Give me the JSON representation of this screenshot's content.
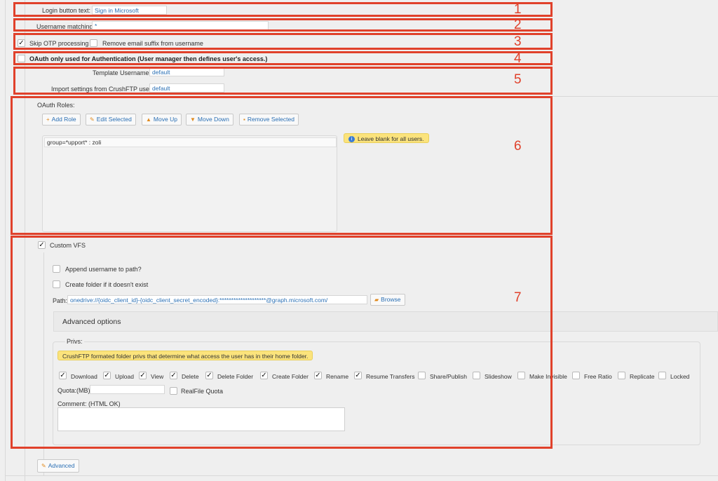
{
  "login": {
    "label": "Login button text:",
    "value": "Sign in Microsoft"
  },
  "username_matching": {
    "label": "Username matching:",
    "value": "*"
  },
  "options": {
    "skip_otp": {
      "label": "Skip OTP processing",
      "checked": true
    },
    "remove_suffix": {
      "label": "Remove email suffix from username",
      "checked": false
    },
    "oauth_only": {
      "label": "OAuth only used for Authentication (User manager then defines user's access.)",
      "checked": false
    }
  },
  "template_username": {
    "label": "Template Username:",
    "value": "default"
  },
  "import_settings": {
    "label": "Import settings from CrushFTP user:",
    "value": "default"
  },
  "roles": {
    "title": "OAuth Roles:",
    "buttons": {
      "add": "Add Role",
      "edit": "Edit Selected",
      "up": "Move Up",
      "down": "Move Down",
      "remove": "Remove Selected"
    },
    "items": [
      "group=*upport* : zoli"
    ],
    "hint": "Leave blank for all users."
  },
  "vfs": {
    "custom_label": "Custom VFS",
    "custom_checked": true,
    "append_label": "Append username to path?",
    "create_label": "Create folder if it doesn't exist",
    "path_label": "Path:",
    "path_value": "onedrive://{oidc_client_id}-{oidc_client_secret_encoded}:********************@graph.microsoft.com/",
    "browse": "Browse",
    "advanced_options": "Advanced options",
    "privs_title": "Privs:",
    "privs_note": "CrushFTP formated folder privs that determine what access the user has in their home folder.",
    "privs": [
      {
        "label": "Download",
        "checked": true
      },
      {
        "label": "Upload",
        "checked": true
      },
      {
        "label": "View",
        "checked": true
      },
      {
        "label": "Delete",
        "checked": true
      },
      {
        "label": "Delete Folder",
        "checked": true
      },
      {
        "label": "Create Folder",
        "checked": true
      },
      {
        "label": "Rename",
        "checked": true
      },
      {
        "label": "Resume Transfers",
        "checked": true
      },
      {
        "label": "Share/Publish",
        "checked": false
      },
      {
        "label": "Slideshow",
        "checked": false
      },
      {
        "label": "Make Invisible",
        "checked": false
      },
      {
        "label": "Free Ratio",
        "checked": false
      },
      {
        "label": "Replicate",
        "checked": false
      },
      {
        "label": "Locked",
        "checked": false
      }
    ],
    "quota_label": "Quota:(MB)",
    "quota_value": "",
    "realfile_label": "RealFile Quota",
    "comment_label": "Comment: (HTML OK)",
    "comment_value": ""
  },
  "advanced_button": "Advanced",
  "annotations": [
    "1",
    "2",
    "3",
    "4",
    "5",
    "6",
    "7"
  ],
  "colors": {
    "annotation": "#e0412b",
    "link": "#2a6fb4",
    "note_bg": "#fbe37c"
  }
}
